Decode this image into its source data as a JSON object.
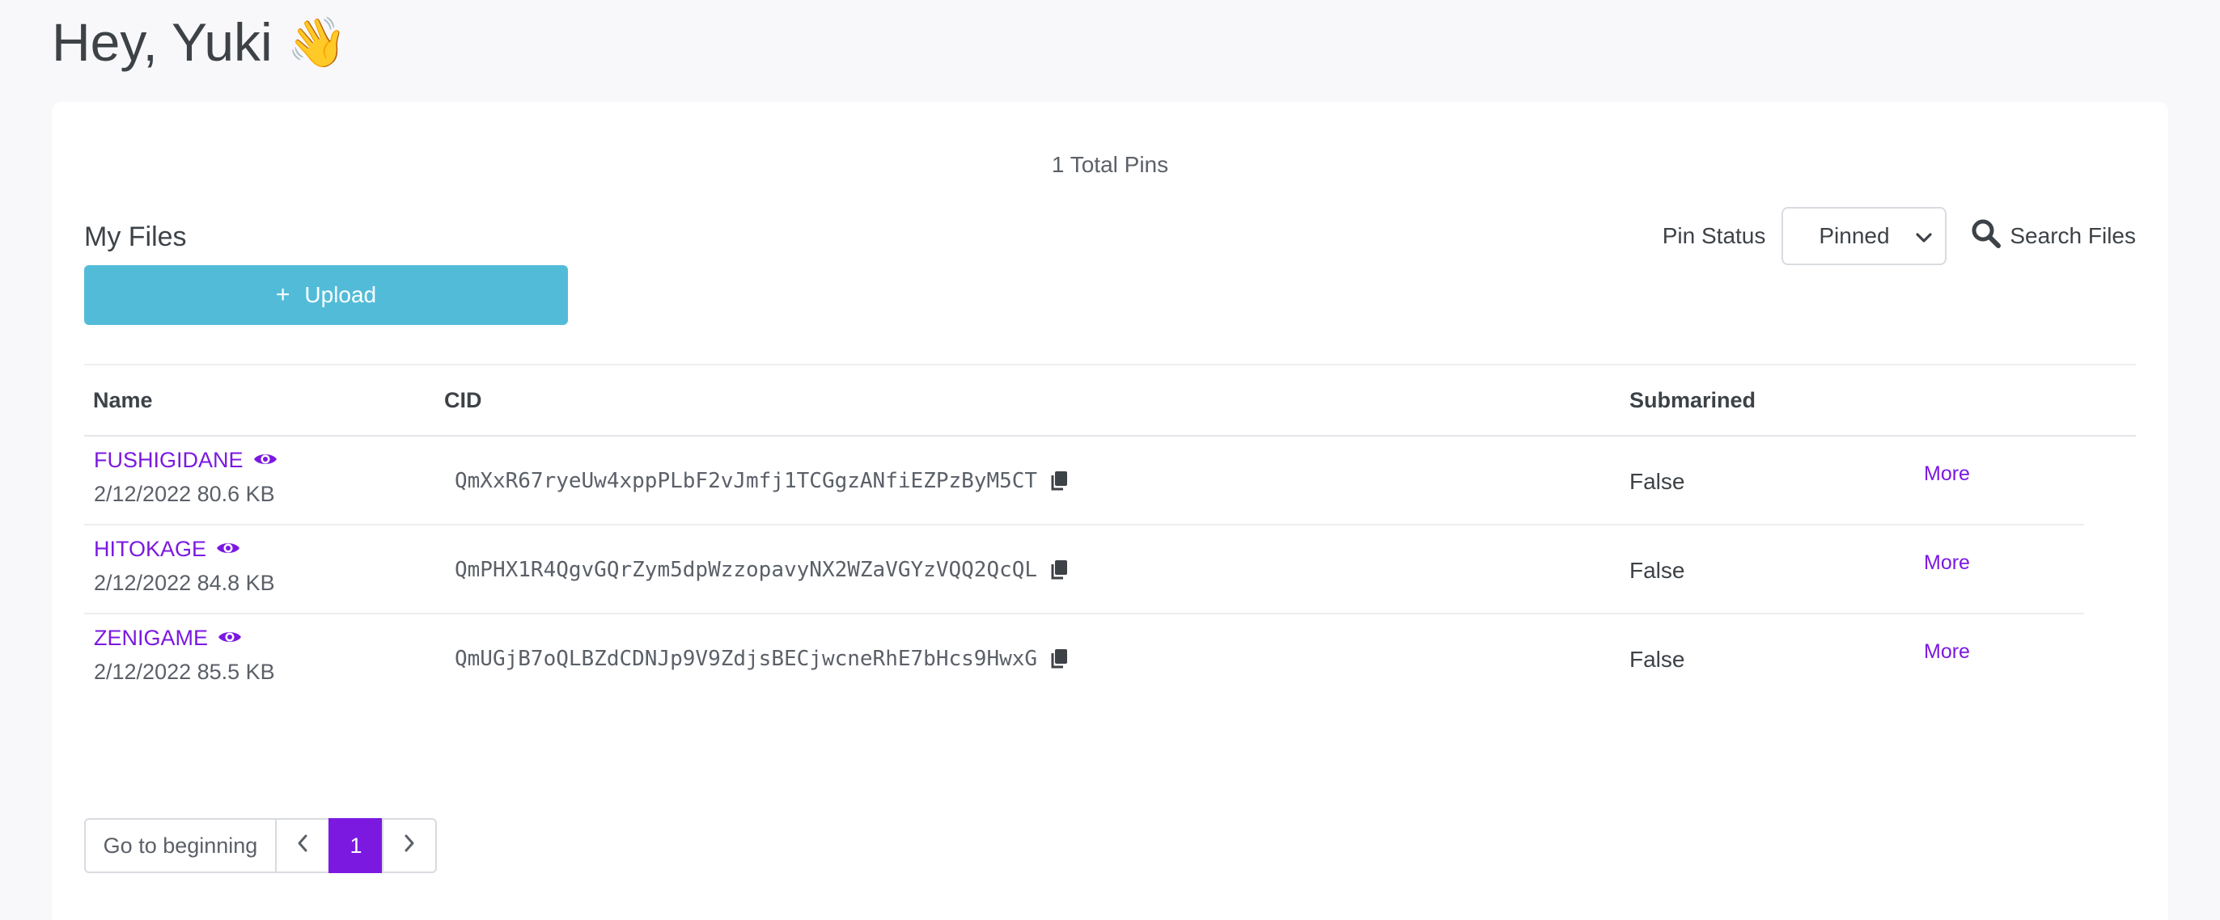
{
  "greeting": {
    "text": "Hey, Yuki",
    "emoji": "👋"
  },
  "summary": {
    "total_pins": "1 Total Pins"
  },
  "files_section": {
    "title": "My Files",
    "upload_label": "Upload",
    "pin_status_label": "Pin Status",
    "pin_status_value": "Pinned",
    "search_label": "Search Files"
  },
  "table": {
    "headers": {
      "name": "Name",
      "cid": "CID",
      "submarined": "Submarined"
    },
    "rows": [
      {
        "name": "FUSHIGIDANE",
        "meta": "2/12/2022 80.6 KB",
        "cid": "QmXxR67ryeUw4xppPLbF2vJmfj1TCGgzANfiEZPzByM5CT",
        "submarined": "False",
        "action": "More"
      },
      {
        "name": "HITOKAGE",
        "meta": "2/12/2022 84.8 KB",
        "cid": "QmPHX1R4QgvGQrZym5dpWzzopavyNX2WZaVGYzVQQ2QcQL",
        "submarined": "False",
        "action": "More"
      },
      {
        "name": "ZENIGAME",
        "meta": "2/12/2022 85.5 KB",
        "cid": "QmUGjB7oQLBZdCDNJp9V9ZdjsBECjwcneRhE7bHcs9HwxG",
        "submarined": "False",
        "action": "More"
      }
    ]
  },
  "pagination": {
    "first_label": "Go to beginning",
    "current_page": "1"
  },
  "colors": {
    "accent": "#7b19e0",
    "upload_button": "#52bcd8",
    "background": "#f8f8fa"
  },
  "icons": {
    "preview": "eye-icon",
    "copy": "copy-icon",
    "search": "search-icon",
    "prev": "chevron-left-icon",
    "next": "chevron-right-icon",
    "dropdown": "chevron-down-icon"
  }
}
